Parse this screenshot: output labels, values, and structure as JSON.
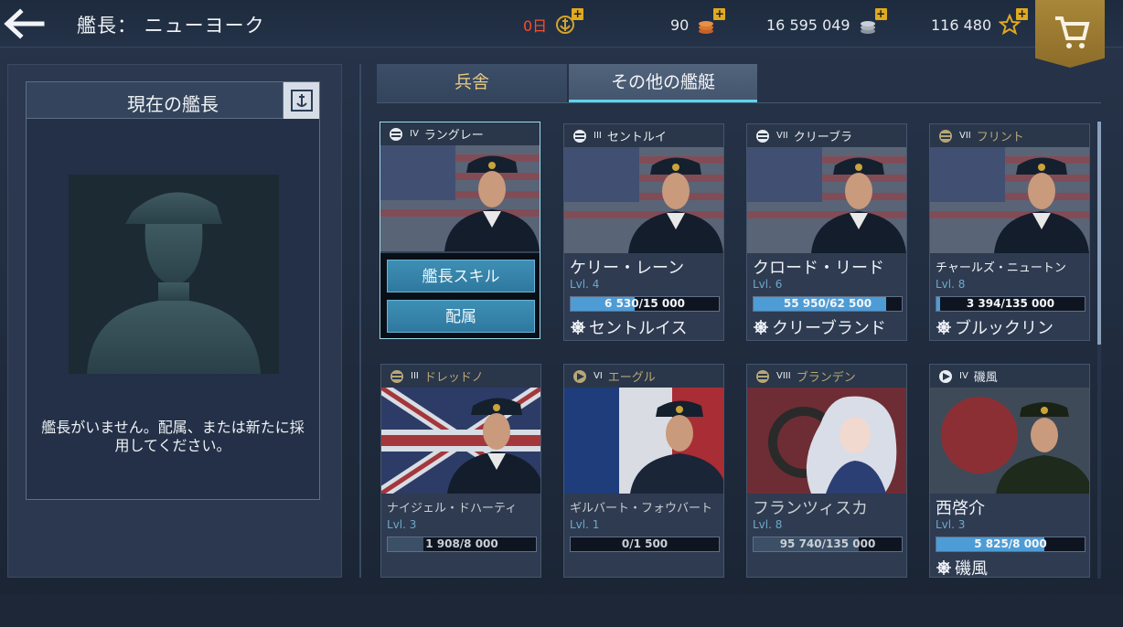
{
  "header": {
    "title": "艦長： ニューヨーク",
    "days_value": "0日",
    "credits_value": "90",
    "silver_value": "16 595 049",
    "xp_value": "116 480",
    "plus_label": "+",
    "colors": {
      "days": "#ff4b2b",
      "gold": "#e0a91e",
      "shop": "#a98638"
    }
  },
  "left_panel": {
    "heading": "現在の艦長",
    "empty_text": "艦長がいません。配属、または新たに採用してください。"
  },
  "tabs": [
    {
      "label": "兵舎",
      "active": false
    },
    {
      "label": "その他の艦艇",
      "active": true
    }
  ],
  "cards": [
    {
      "tier": "IV",
      "ship_header": "ラングレー",
      "nation": "usa",
      "selected": true,
      "actions": [
        "艦長スキル",
        "配属"
      ]
    },
    {
      "tier": "III",
      "ship_header": "セントルイ",
      "nation": "usa",
      "name": "ケリー・レーン",
      "level": "Lvl. 4",
      "progress_text": "6 530/15 000",
      "progress": 0.435,
      "ship": "セントルイス"
    },
    {
      "tier": "VII",
      "ship_header": "クリーブラ",
      "nation": "usa",
      "name": "クロード・リード",
      "level": "Lvl. 6",
      "progress_text": "55 950/62 500",
      "progress": 0.895,
      "ship": "クリーブランド"
    },
    {
      "tier": "VII",
      "ship_header": "フリント",
      "nation": "usa",
      "name": "チャールズ・ニュートン",
      "level": "Lvl. 8",
      "progress_text": "3 394/135 000",
      "progress": 0.025,
      "ship": "ブルックリン"
    },
    {
      "tier": "III",
      "ship_header": "ドレッドノ",
      "nation": "uk",
      "name": "ナイジェル・ドハーティ",
      "level": "Lvl. 3",
      "progress_text": "1 908/8 000",
      "progress": 0.24
    },
    {
      "tier": "VI",
      "ship_header": "エーグル",
      "nation": "france",
      "name": "ギルバート・フォウバート",
      "level": "Lvl. 1",
      "progress_text": "0/1 500",
      "progress": 0.0
    },
    {
      "tier": "VIII",
      "ship_header": "ブランデン",
      "nation": "germany",
      "name": "フランツィスカ",
      "level": "Lvl. 8",
      "progress_text": "95 740/135 000",
      "progress": 0.709
    },
    {
      "tier": "IV",
      "ship_header": "磯風",
      "nation": "japan",
      "name": "西啓介",
      "level": "Lvl. 3",
      "progress_text": "5 825/8 000",
      "progress": 0.728,
      "ship": "磯風"
    }
  ]
}
